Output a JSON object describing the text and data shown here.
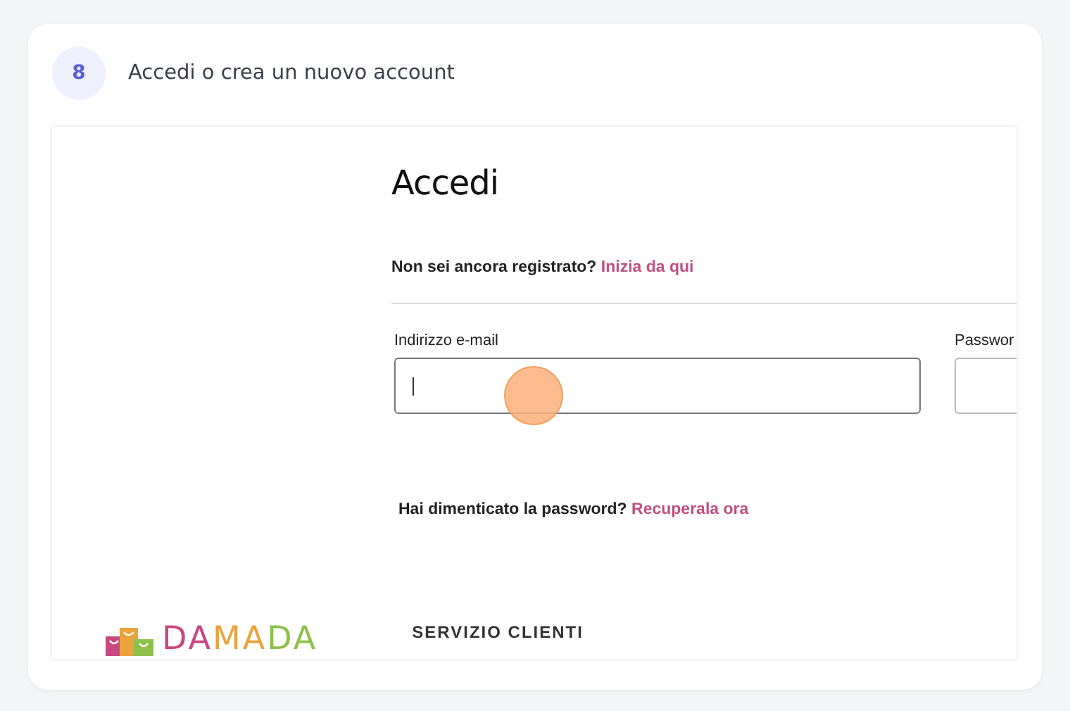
{
  "step": {
    "number": "8",
    "title": "Accedi o crea un nuovo account"
  },
  "login": {
    "heading": "Accedi",
    "register_prompt": "Non sei ancora registrato?",
    "register_link": "Inizia da qui",
    "fields": [
      {
        "label": "Indirizzo e-mail",
        "focused": true
      },
      {
        "label": "Passwor",
        "focused": false
      }
    ],
    "forgot_prompt": "Hai dimenticato la password?",
    "forgot_link": "Recuperala ora"
  },
  "footer": {
    "logo": [
      {
        "text": "DA",
        "color": "#c9477f"
      },
      {
        "text": "MA",
        "color": "#eaa23c"
      },
      {
        "text": "DA",
        "color": "#8dc04b"
      }
    ],
    "heading": "SERVIZIO CLIENTI"
  }
}
